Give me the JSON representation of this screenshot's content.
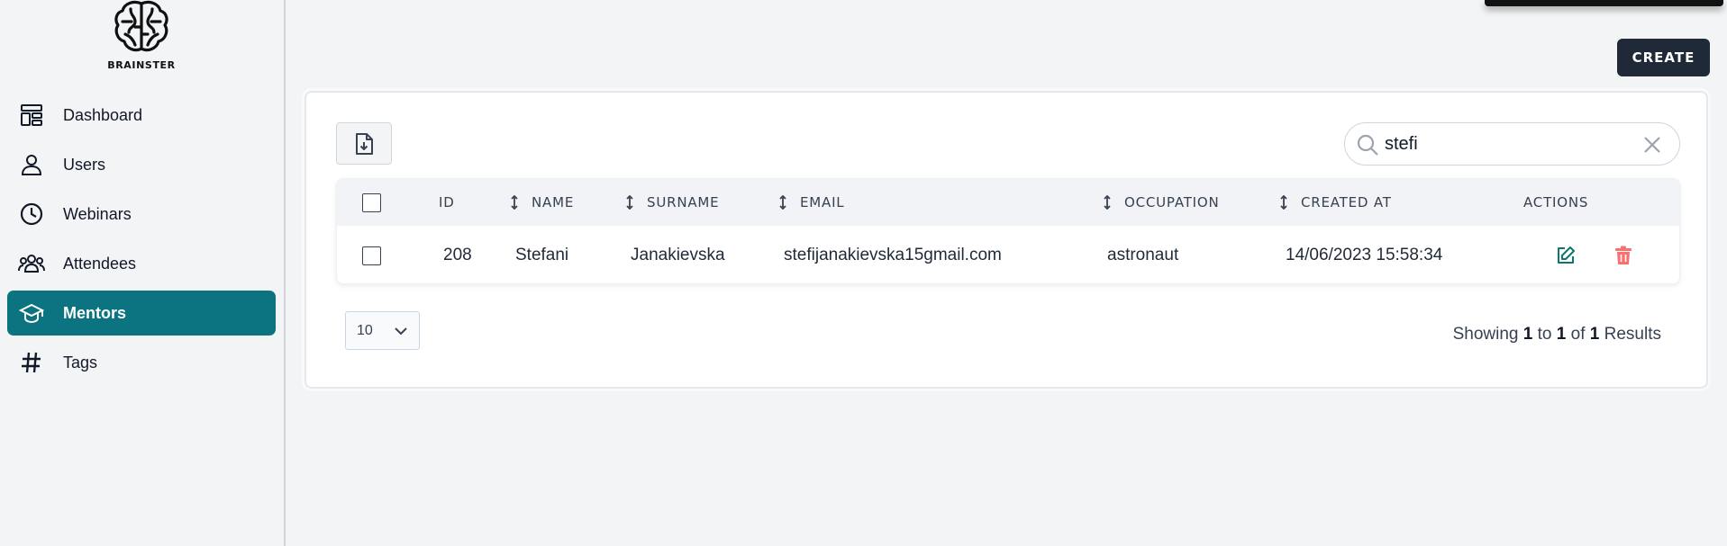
{
  "app": {
    "logo_text": "BRAINSTER"
  },
  "sidebar": {
    "items": [
      {
        "label": "Dashboard",
        "icon": "dashboard-icon"
      },
      {
        "label": "Users",
        "icon": "user-icon"
      },
      {
        "label": "Webinars",
        "icon": "clock-icon"
      },
      {
        "label": "Attendees",
        "icon": "group-icon"
      },
      {
        "label": "Mentors",
        "icon": "graduation-cap-icon",
        "active": true
      },
      {
        "label": "Tags",
        "icon": "hashtag-icon"
      }
    ]
  },
  "toolbar": {
    "create_label": "CREATE"
  },
  "search": {
    "value": "stefi"
  },
  "table": {
    "columns": [
      "ID",
      "NAME",
      "SURNAME",
      "EMAIL",
      "OCCUPATION",
      "CREATED AT",
      "ACTIONS"
    ],
    "rows": [
      {
        "id": "208",
        "name": "Stefani",
        "surname": "Janakievska",
        "email": "stefijanakievska15gmail.com",
        "occupation": "astronaut",
        "created_at": "14/06/2023 15:58:34"
      }
    ]
  },
  "pagination": {
    "per_page": "10",
    "showing_prefix": "Showing",
    "from": "1",
    "to_word": "to",
    "to": "1",
    "of_word": "of",
    "total": "1",
    "suffix": "Results"
  },
  "colors": {
    "accent": "#0b7480",
    "edit": "#0f766e",
    "delete": "#f87171",
    "button_dark": "#1f2937"
  }
}
